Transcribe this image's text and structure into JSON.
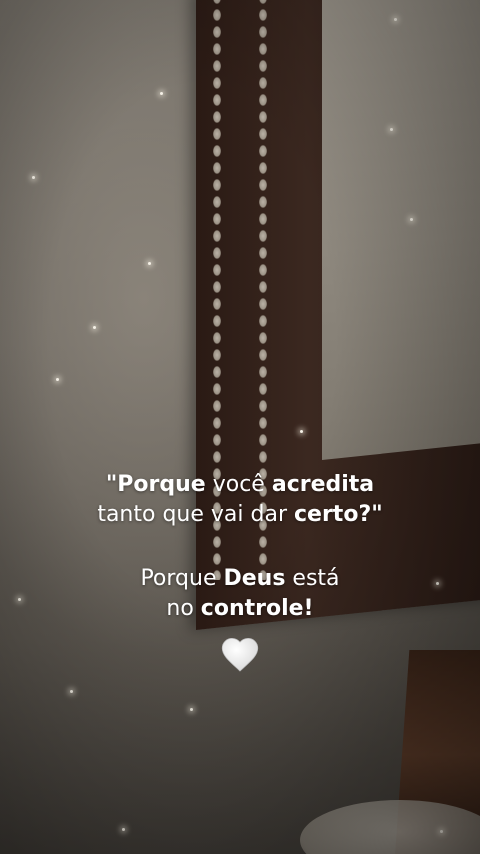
{
  "quote": {
    "line1": {
      "a": "\"Porque",
      "b": " você ",
      "c": "acredita"
    },
    "line2": {
      "a": "tanto que vai dar ",
      "b": "certo?\""
    },
    "line3": {
      "a": "Porque ",
      "b": "Deus",
      "c": " está"
    },
    "line4": {
      "a": "no ",
      "b": "controle!"
    }
  },
  "decor": {
    "heart_icon": "white-heart-icon",
    "sparkle_color": "#f4f0e6",
    "frame_color": "#3b2820"
  }
}
